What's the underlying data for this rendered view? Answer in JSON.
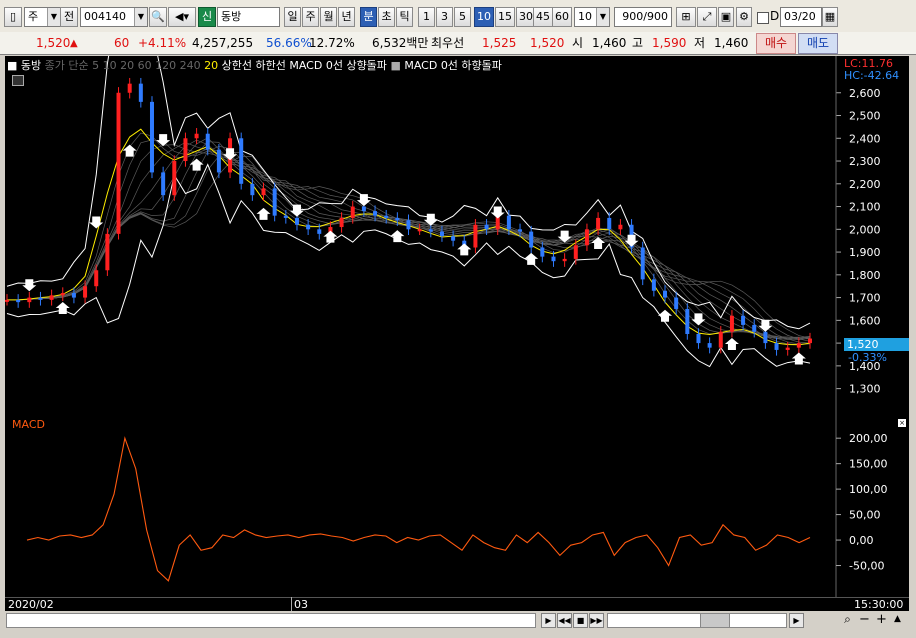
{
  "toolbar": {
    "market": "주",
    "prev": "전",
    "code": "004140",
    "badge": "신",
    "name": "동방",
    "periods": [
      "일",
      "주",
      "월",
      "년",
      "분",
      "초",
      "틱"
    ],
    "selected_period": "분",
    "intervals": [
      "1",
      "3",
      "5",
      "10",
      "15",
      "30",
      "45",
      "60"
    ],
    "selected_interval": "10",
    "count": "10",
    "range": "900/900",
    "checkbox_label": "D",
    "date": "03/20"
  },
  "quote": {
    "price": "1,520",
    "change": "60",
    "change_pct": "+4.11%",
    "volume": "4,257,255",
    "ratio": "56.66%",
    "turnover": "12.72%",
    "amount": "6,532백만",
    "best_label": "최우선",
    "best_ask": "1,525",
    "best_bid": "1,520",
    "open_label": "시",
    "open": "1,460",
    "high_label": "고",
    "high": "1,590",
    "low_label": "저",
    "low": "1,460",
    "buy": "매수",
    "sell": "매도"
  },
  "legend": {
    "stock": "동방",
    "ma_label": "종가 단순",
    "ma_periods": [
      "5",
      "10",
      "20",
      "60",
      "120",
      "240"
    ],
    "band_period": "20",
    "band_label": "상한선 하한선",
    "macd_up": "MACD 0선 상향돌파",
    "macd_down": "MACD 0선 하향돌파",
    "lc": "LC:11.76",
    "hc": "HC:-42.64",
    "current_tag": "1,520",
    "current_pct": "-0.33%"
  },
  "colors": {
    "up": "#ff2020",
    "down": "#2f7bff",
    "ma_short": "#ffee00",
    "band": "#ffffff",
    "macd": "#ff5a10",
    "tag_bg": "#1fa0e0"
  },
  "chart_data": [
    {
      "type": "candlestick",
      "x": [
        "2020/02",
        "03"
      ],
      "ylim": [
        1250,
        2700
      ],
      "yticks": [
        "2,600",
        "2,500",
        "2,400",
        "2,300",
        "2,200",
        "2,100",
        "2,000",
        "1,900",
        "1,800",
        "1,700",
        "1,600",
        "1,500",
        "1,400",
        "1,300"
      ],
      "series": [
        {
          "values": [
            1690,
            1680,
            1700,
            1690,
            1710,
            1720,
            1700,
            1750,
            1820,
            1980,
            2600,
            2640,
            2560,
            2250,
            2150,
            2300,
            2400,
            2420,
            2350,
            2250,
            2400,
            2200,
            2150,
            2180,
            2060,
            2050,
            2020,
            2000,
            1980,
            2010,
            2050,
            2100,
            2080,
            2060,
            2050,
            2040,
            2000,
            2000,
            1990,
            1970,
            1950,
            1920,
            2020,
            2000,
            2060,
            2000,
            1990,
            1920,
            1880,
            1860,
            1870,
            1930,
            2000,
            2050,
            2000,
            2020,
            1920,
            1780,
            1730,
            1700,
            1650,
            1540,
            1500,
            1480,
            1550,
            1620,
            1580,
            1550,
            1500,
            1470,
            1480,
            1500,
            1520
          ]
        }
      ],
      "current": "1,520",
      "current_pct": "-0.33%"
    },
    {
      "type": "line",
      "title": "MACD",
      "ylim": [
        -100,
        220
      ],
      "yticks": [
        "200,00",
        "150,00",
        "100,00",
        "50,00",
        "0,00",
        "-50,00"
      ],
      "series": [
        {
          "name": "MACD",
          "values": [
            0,
            5,
            0,
            8,
            10,
            5,
            10,
            30,
            90,
            200,
            140,
            20,
            -60,
            -80,
            -10,
            10,
            -20,
            -15,
            10,
            5,
            20,
            10,
            5,
            8,
            10,
            5,
            10,
            12,
            8,
            5,
            -2,
            5,
            10,
            8,
            -5,
            5,
            0,
            8,
            10,
            -5,
            -20,
            10,
            -5,
            -15,
            -20,
            10,
            -5,
            15,
            -5,
            -30,
            -10,
            -5,
            10,
            15,
            -30,
            -5,
            5,
            10,
            -15,
            -50,
            5,
            10,
            -10,
            -5,
            30,
            10,
            5,
            -20,
            -10,
            10,
            5,
            -5,
            5
          ]
        }
      ]
    }
  ],
  "footer": {
    "date_left": "2020/02",
    "date_mid": "03",
    "time": "15:30:00"
  }
}
